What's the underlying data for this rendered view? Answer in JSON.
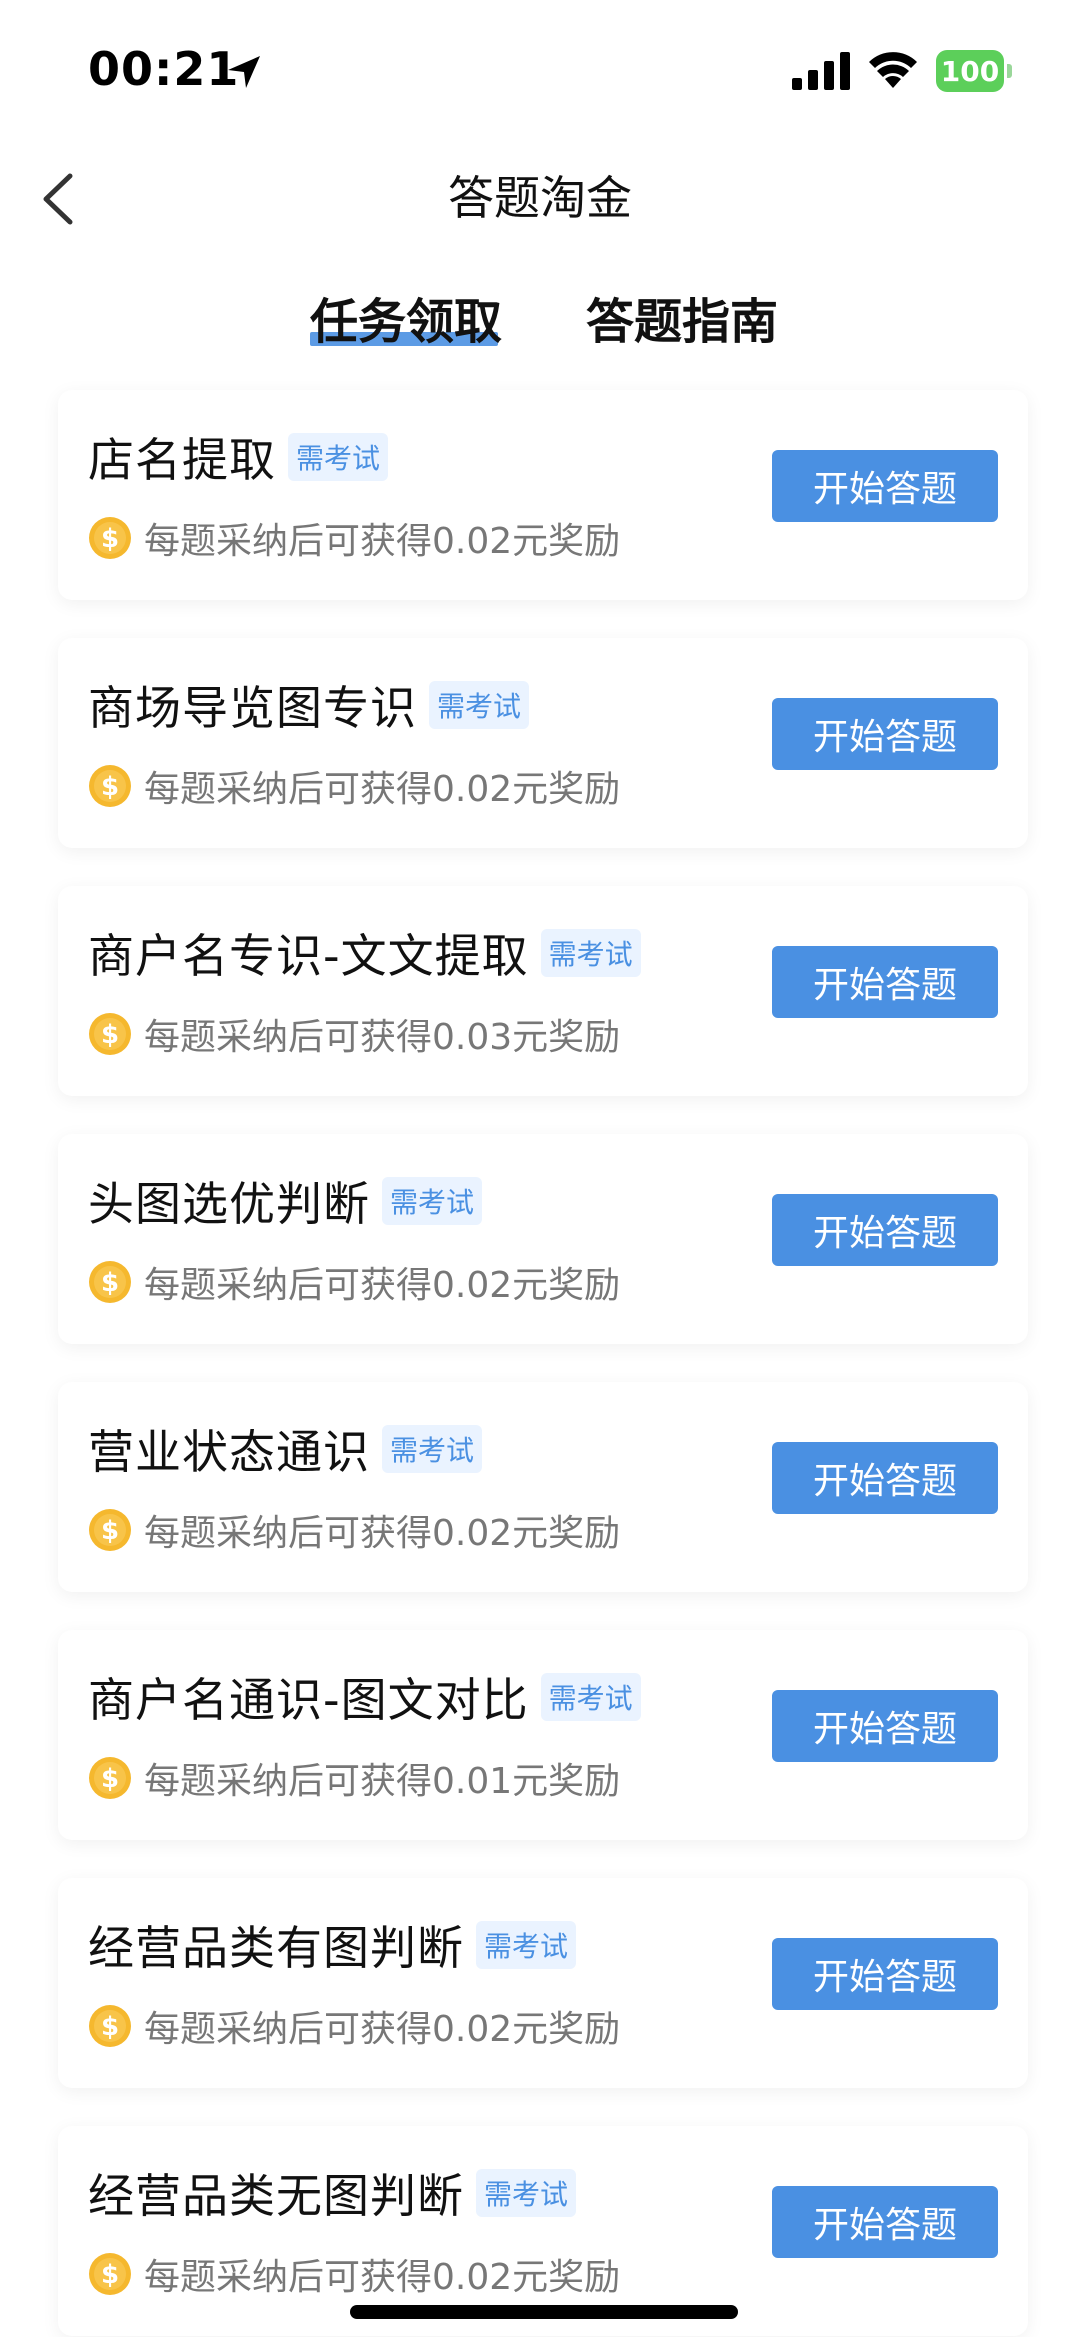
{
  "status": {
    "time": "00:21",
    "battery": "100",
    "icons": {
      "location": "location-arrow-icon",
      "signal": "signal-icon",
      "wifi": "wifi-icon",
      "battery": "battery-icon"
    }
  },
  "header": {
    "title": "答题淘金",
    "back_icon": "chevron-left-icon"
  },
  "tabs": [
    {
      "label": "任务领取",
      "active": true
    },
    {
      "label": "答题指南",
      "active": false
    }
  ],
  "tasks": [
    {
      "title": "店名提取",
      "badge": "需考试",
      "reward": "每题采纳后可获得0.02元奖励",
      "button": "开始答题"
    },
    {
      "title": "商场导览图专识",
      "badge": "需考试",
      "reward": "每题采纳后可获得0.02元奖励",
      "button": "开始答题"
    },
    {
      "title": "商户名专识-文文提取",
      "badge": "需考试",
      "reward": "每题采纳后可获得0.03元奖励",
      "button": "开始答题"
    },
    {
      "title": "头图选优判断",
      "badge": "需考试",
      "reward": "每题采纳后可获得0.02元奖励",
      "button": "开始答题"
    },
    {
      "title": "营业状态通识",
      "badge": "需考试",
      "reward": "每题采纳后可获得0.02元奖励",
      "button": "开始答题"
    },
    {
      "title": "商户名通识-图文对比",
      "badge": "需考试",
      "reward": "每题采纳后可获得0.01元奖励",
      "button": "开始答题"
    },
    {
      "title": "经营品类有图判断",
      "badge": "需考试",
      "reward": "每题采纳后可获得0.02元奖励",
      "button": "开始答题"
    },
    {
      "title": "经营品类无图判断",
      "badge": "需考试",
      "reward": "每题采纳后可获得0.02元奖励",
      "button": "开始答题"
    }
  ],
  "colors": {
    "accent": "#4a90e2",
    "badge_bg": "#eaf3ff",
    "coin": "#f5b82e",
    "battery": "#5ccf5a"
  }
}
